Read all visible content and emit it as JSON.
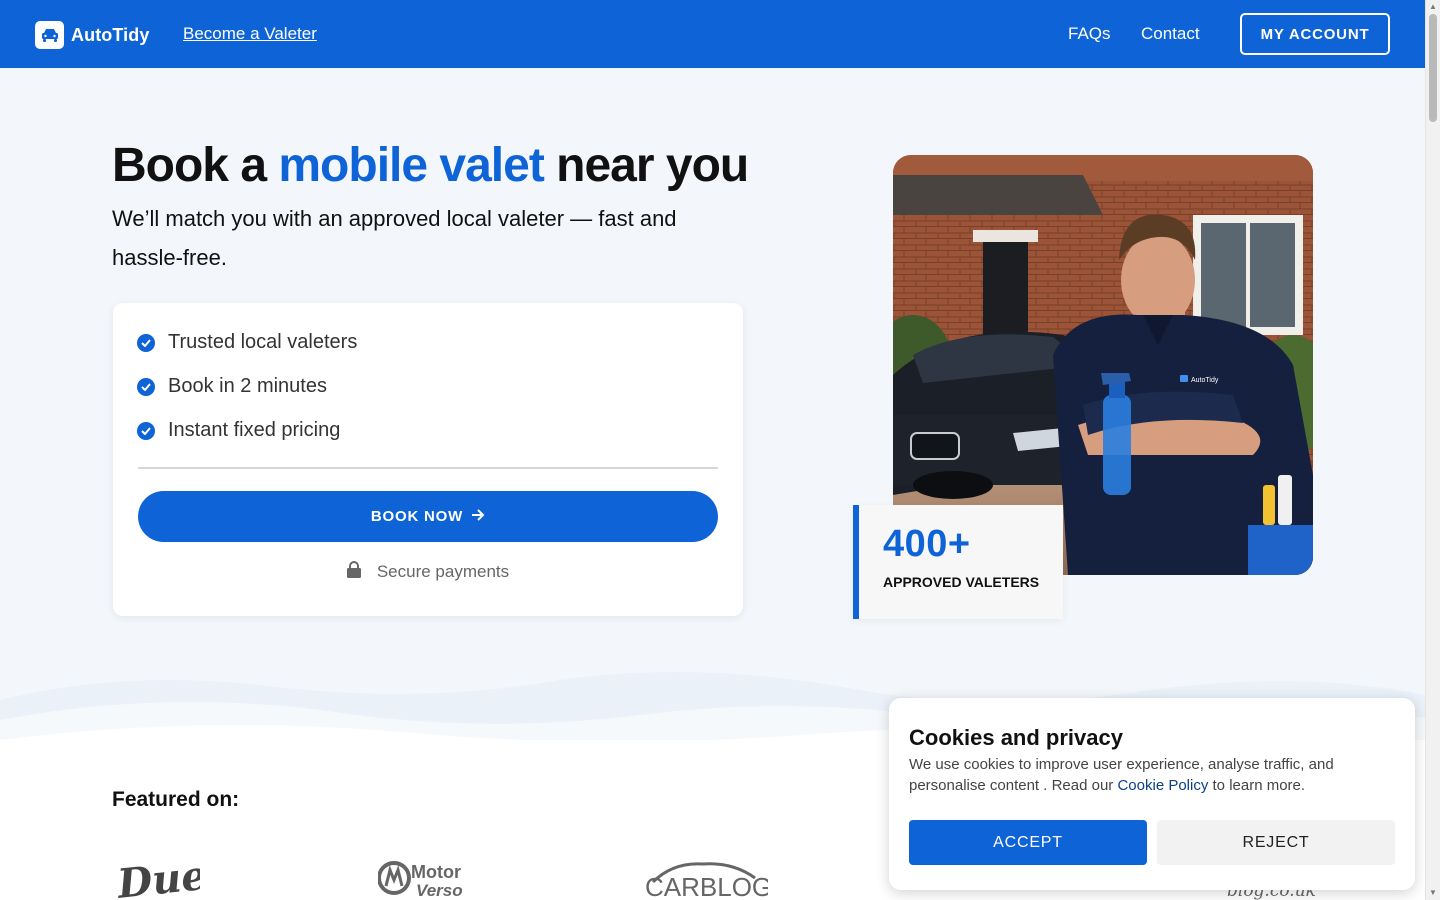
{
  "header": {
    "brand": "AutoTidy",
    "become": "Become a Valeter",
    "faqs": "FAQs",
    "contact": "Contact",
    "account": "MY ACCOUNT"
  },
  "hero": {
    "title_pre": "Book a ",
    "title_accent": "mobile valet",
    "title_post": " near you",
    "subtitle": "We’ll match you with an approved local valeter — fast and hassle-free."
  },
  "card": {
    "features": [
      "Trusted local valeters",
      "Book in 2 minutes",
      "Instant fixed pricing"
    ],
    "book": "BOOK NOW",
    "secure": "Secure payments"
  },
  "stat": {
    "number": "400+",
    "label": "APPROVED VALETERS"
  },
  "photo": {
    "shirt_logo": "AutoTidy"
  },
  "featured": {
    "title": "Featured on:",
    "logos": [
      "Duel",
      "Motor Verso",
      "CARBLOG",
      "blog.co.uk"
    ]
  },
  "cookie": {
    "title": "Cookies and privacy",
    "body_pre": "We use cookies to improve user experience, analyse traffic, and personalise content . Read our ",
    "link": "Cookie Policy",
    "body_post": " to learn more.",
    "accept": "ACCEPT",
    "reject": "REJECT"
  },
  "colors": {
    "brand_blue": "#0e63d6",
    "page_bg": "#f3f7fb"
  }
}
